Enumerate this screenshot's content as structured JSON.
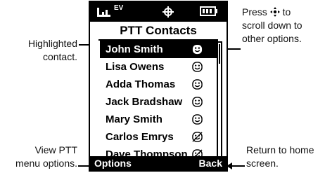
{
  "callouts": {
    "highlighted": [
      "Highlighted",
      "contact."
    ],
    "press": [
      "Press",
      "to",
      "scroll down to",
      "other options."
    ],
    "view_menu": [
      "View PTT",
      "menu options."
    ],
    "return_home": [
      "Return to home",
      "screen."
    ]
  },
  "screen": {
    "title": "PTT Contacts",
    "contacts": [
      {
        "name": "John Smith",
        "icon": "smiley-icon",
        "selected": true
      },
      {
        "name": "Lisa Owens",
        "icon": "smiley-icon"
      },
      {
        "name": "Adda Thomas",
        "icon": "smiley-icon"
      },
      {
        "name": "Jack Bradshaw",
        "icon": "smiley-icon"
      },
      {
        "name": "Mary Smith",
        "icon": "smiley-icon"
      },
      {
        "name": "Carlos Emrys",
        "icon": "blocked-smiley-icon"
      },
      {
        "name": "Dave Thompson",
        "icon": "blocked-smiley-icon"
      }
    ],
    "softkeys": {
      "left": "Options",
      "right": "Back"
    },
    "status": {
      "signal": "signal-icon",
      "ev": "EV",
      "nav": "crosshair-icon",
      "battery": "battery-icon"
    }
  }
}
